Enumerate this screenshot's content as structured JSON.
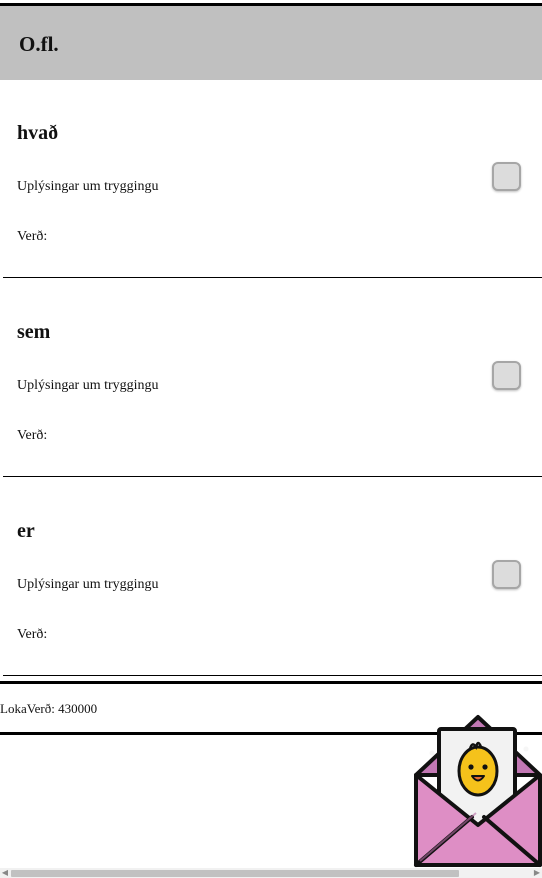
{
  "header": {
    "title": "O.fl."
  },
  "sections": [
    {
      "title": "hvað",
      "info_label": "Uplýsingar um tryggingu",
      "price_label": "Verð:"
    },
    {
      "title": "sem",
      "info_label": "Uplýsingar um tryggingu",
      "price_label": "Verð:"
    },
    {
      "title": "er",
      "info_label": "Uplýsingar um tryggingu",
      "price_label": "Verð:"
    }
  ],
  "total": {
    "label": "LokaVerð: 430000"
  },
  "colors": {
    "header_bg": "#c0c0c0",
    "envelope": "#de8ec5",
    "envelope_shadow": "#b56ba3",
    "chick": "#f5c21b"
  },
  "icons": {
    "mail_widget": "envelope-chick-icon"
  }
}
